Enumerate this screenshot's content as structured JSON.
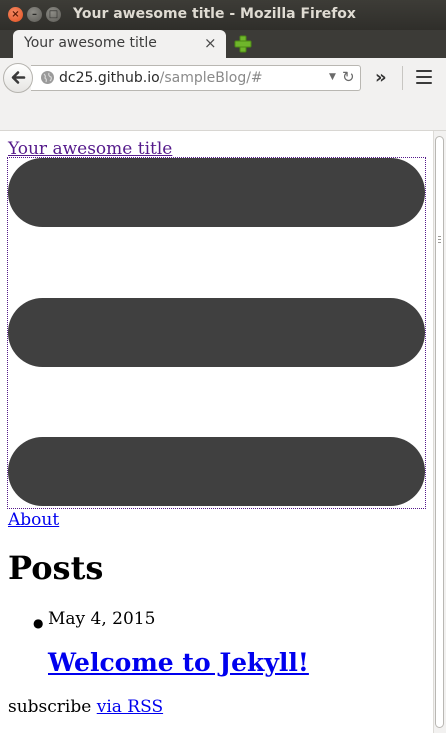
{
  "window": {
    "title": "Your awesome title - Mozilla Firefox",
    "close_glyph": "×",
    "min_glyph": "–",
    "max_glyph": "□"
  },
  "tab": {
    "label": "Your awesome title",
    "close_glyph": "×"
  },
  "navbar": {
    "url_host": "dc25.github.io",
    "url_path": "/sampleBlog/#",
    "overflow_glyph": "»",
    "reload_glyph": "↻",
    "dropdown_glyph": "▼"
  },
  "page": {
    "site_title": "Your awesome title",
    "nav_link": "About",
    "posts_heading": "Posts",
    "posts": [
      {
        "date": "May 4, 2015",
        "title": "Welcome to Jekyll!"
      }
    ],
    "subscribe_text": "subscribe ",
    "rss_link": "via RSS"
  },
  "colors": {
    "link": "#0000ee",
    "visited_link": "#551a8b",
    "hamburger_bar": "#404040"
  },
  "icons": {
    "window_close": "close-icon",
    "window_minimize": "minimize-icon",
    "window_maximize": "maximize-icon",
    "new_tab": "plus-icon",
    "back": "back-arrow-icon",
    "site_identity": "globe-icon",
    "menu": "hamburger-menu-icon"
  }
}
